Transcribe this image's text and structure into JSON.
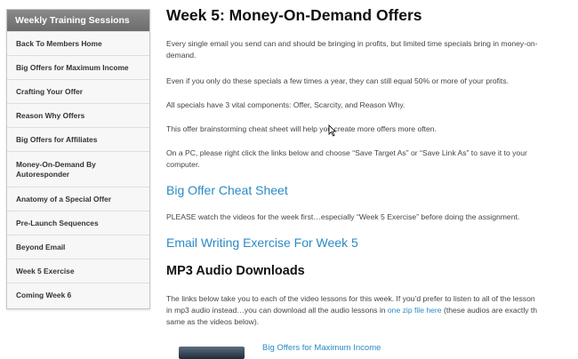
{
  "sidebar": {
    "title": "Weekly Training Sessions",
    "items": [
      {
        "label": "Back To Members Home"
      },
      {
        "label": "Big Offers for Maximum Income"
      },
      {
        "label": "Crafting Your Offer"
      },
      {
        "label": "Reason Why Offers"
      },
      {
        "label": "Big Offers for Affiliates"
      },
      {
        "label_line1": "Money-On-Demand By",
        "label_line2": "Autoresponder"
      },
      {
        "label": "Anatomy of a Special Offer"
      },
      {
        "label": "Pre-Launch Sequences"
      },
      {
        "label": "Beyond Email"
      },
      {
        "label": "Week 5 Exercise"
      },
      {
        "label": "Coming Week 6"
      }
    ]
  },
  "main": {
    "title": "Week 5: Money-On-Demand Offers",
    "para1_line1": "Every single email you send can and should be bringing in profits, but limited time specials bring in money-on-",
    "para1_line2": "demand.",
    "para2": "Even if you only do these specials a few times a year, they can still equal 50% or more of your profits.",
    "para3": "All specials have 3 vital components: Offer, Scarcity, and Reason Why.",
    "para4": "This offer brainstorming cheat sheet will help you create more offers more often.",
    "para5_line1": "On a PC, please right click the links below and choose “Save Target As” or “Save Link As” to save it to your",
    "para5_line2": "computer.",
    "link_cheat_sheet": "Big Offer Cheat Sheet",
    "para6": "PLEASE watch the videos for the week first…especially “Week 5 Exercise” before doing the assignment.",
    "link_exercise": "Email Writing Exercise For Week 5",
    "mp3_heading": "MP3 Audio Downloads",
    "para7_line1": "The links below take you to each of the video lessons for this week.  If you’d prefer to listen to all of the lesson",
    "para7_line2_before": "in mp3 audio instead…you can download all the audio lessons in ",
    "para7_line2_link": "one zip file here",
    "para7_line2_after": " (these audios are exactly th",
    "para7_line3": "same as the videos below).",
    "audio_link": "Big Offers for Maximum Income"
  },
  "colors": {
    "link": "#2a8bc4",
    "sidebar_header": "#7a7a7a",
    "heading": "#111111"
  }
}
